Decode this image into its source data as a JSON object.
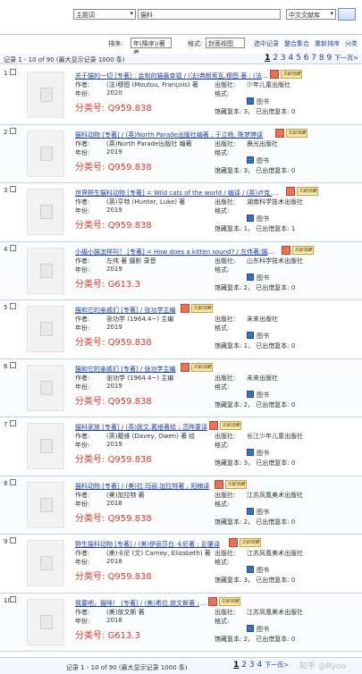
{
  "search": {
    "field": "主题词",
    "query": "猫科",
    "library": "中文文献库"
  },
  "toolbar": {
    "sort_label": "排序:",
    "sort_value": "年(降序)/著者",
    "format_label": "格式:",
    "format_value": "封面视图",
    "link_selected": "选中记录",
    "link_save": "整合集合",
    "link_resort": "重新排序",
    "link_share": "分类"
  },
  "summary": "记录 1 - 10 of 90 (最大显示记录 1000 条)",
  "pager": {
    "current": "1",
    "pages": [
      "2",
      "3",
      "4",
      "5",
      "6",
      "7",
      "8",
      "9"
    ],
    "next": "下一页>"
  },
  "labels": {
    "author": "作者:",
    "year": "年份:",
    "publisher": "出版社:",
    "format": "格式:",
    "callno_prefix": "分类号:",
    "book": "图书",
    "fulltext_badge": "文献馆藏"
  },
  "records": [
    {
      "idx": "1",
      "title": "关于猫的一切 [专著] : 会和的猫最幸福 / (法)弗朗索瓦.穆图 著 ; (法)奎",
      "author": "(法)穆图 (Moutou, François) 著",
      "year": "2020",
      "publisher": "少年儿童出版社",
      "format": "",
      "callno": "Q959.838",
      "holdings": "馆藏复本: 3， 已出借复本: 0"
    },
    {
      "idx": "2",
      "title": "猫科动物 [专著] / (英)North Parade出版社编著 ; 于立杨, 陈梦婷译",
      "author": "(英)North Parade出版社 编著",
      "year": "2019",
      "publisher": "晨光出版社",
      "format": "",
      "callno": "Q959.838",
      "holdings": "馆藏复本: 3， 已出借复本: 0"
    },
    {
      "idx": "3",
      "title": "世界野生猫科动物 [专著] = Wild cats of the world / 编译 / (英)卢克.亨特著",
      "author": "(英)亨特 (Hunter, Luke) 著",
      "year": "2019",
      "publisher": "湖南科学技术出版社",
      "format": "",
      "callno": "Q959.838",
      "holdings": "馆藏复本: 1， 已出借复本: 1"
    },
    {
      "idx": "4",
      "title": "小猫小猫怎样叫？ [专著] = How does a kitten sound? / 左伟著;摄影;录音",
      "author": "左伟 著 摄影 录音",
      "year": "2019",
      "publisher": "山东科学技术出版社",
      "format": "",
      "callno": "G613.3",
      "holdings": "馆藏复本: 2， 已出借复本: 0"
    },
    {
      "idx": "5",
      "title": "猫和它的亲戚们 [专著] / 张功学主编",
      "author": "张功学 (1964.4~) 主编",
      "year": "2019",
      "publisher": "未来出版社",
      "format": "",
      "callno": "Q959.838",
      "holdings": "馆藏复本: 1， 已出借复本: 0"
    },
    {
      "idx": "6",
      "title": "猫和它的亲戚们 [专著] / 张功学主编",
      "author": "张功学 (1964.4~) 主编",
      "year": "2019",
      "publisher": "未来出版社",
      "format": "",
      "callno": "Q959.838",
      "holdings": "馆藏复本: 2， 已出借复本: 0"
    },
    {
      "idx": "7",
      "title": "猫科家族 [专著] / (英)妮艾.戴维著绘 ; 范晔童译",
      "author": "(英)戴维 (Davey, Owen) 著 绘",
      "year": "2019",
      "publisher": "长江少年儿童出版社",
      "format": "",
      "callno": "Q959.838",
      "holdings": "馆藏复本: 3， 已出借复本: 0"
    },
    {
      "idx": "8",
      "title": "猫科动物 [专著] / (美)拉.玛丽.加拉特著 ; 阳楠译",
      "author": "(美)加拉特 著",
      "year": "2018",
      "publisher": "江苏凤凰美术出版社",
      "format": "",
      "callno": "Q959.838",
      "holdings": "馆藏复本: 2， 已出借复本: 0"
    },
    {
      "idx": "9",
      "title": "野生猫科动物 [专著] / (美)伊丽莎白.卡尼著 ; 彭肇译",
      "author": "(美)卡尼 (文) Carney, Elizabeth) 著",
      "year": "2018",
      "publisher": "江苏凤凰美术出版社",
      "format": "",
      "callno": "Q959.838",
      "holdings": "馆藏复本: 3， 已出借复本: 0"
    },
    {
      "idx": "10",
      "title": "我要吧，猫咪！ [专著] / (美)希拉.放文斯著 ; 阳楠译",
      "author": "(美)放文斯 著",
      "year": "2018",
      "publisher": "江苏凤凰美术出版社",
      "format": "",
      "callno": "G613.3",
      "holdings": "馆藏复本: 2， 已出借复本: 0"
    }
  ],
  "watermark": "知乎 @Ryoo"
}
